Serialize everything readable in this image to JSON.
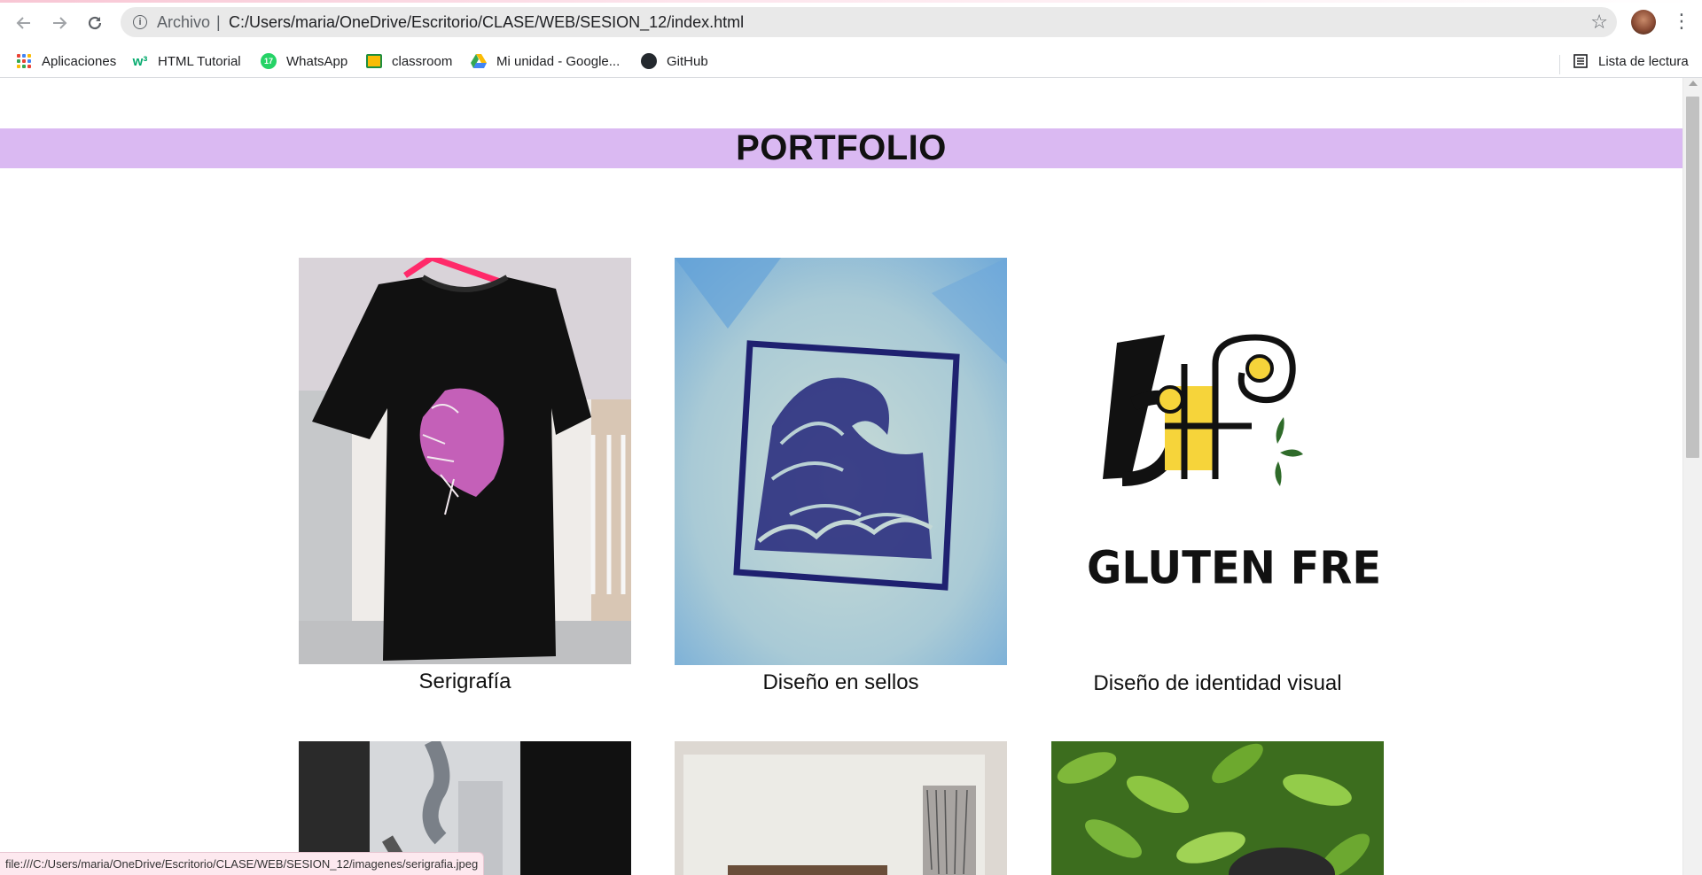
{
  "browser": {
    "archivo_label": "Archivo",
    "separator": "|",
    "url": "C:/Users/maria/OneDrive/Escritorio/CLASE/WEB/SESION_12/index.html",
    "bookmarks": [
      {
        "label": "Aplicaciones",
        "icon": "apps-grid-icon"
      },
      {
        "label": "HTML Tutorial",
        "icon": "w3schools-icon"
      },
      {
        "label": "WhatsApp",
        "icon": "whatsapp-icon"
      },
      {
        "label": "classroom",
        "icon": "classroom-icon"
      },
      {
        "label": "Mi unidad - Google...",
        "icon": "google-drive-icon"
      },
      {
        "label": "GitHub",
        "icon": "github-icon"
      }
    ],
    "reading_list_label": "Lista de lectura",
    "status_url": "file:///C:/Users/maria/OneDrive/Escritorio/CLASE/WEB/SESION_12/imagenes/serigrafia.jpeg"
  },
  "page": {
    "title": "PORTFOLIO",
    "header_color": "#dab9f2",
    "items": [
      {
        "caption": "Serigrafía",
        "image": "tshirt-image"
      },
      {
        "caption": "Diseño en sellos",
        "image": "wave-stamp-image"
      },
      {
        "caption": "Diseño de identidad visual",
        "image": "gluten-free-logo-image",
        "logo_text": "GLUTEN FREE"
      },
      {
        "caption": "",
        "image": "keychain-image"
      },
      {
        "caption": "",
        "image": "paper-image"
      },
      {
        "caption": "",
        "image": "plant-image"
      }
    ]
  }
}
